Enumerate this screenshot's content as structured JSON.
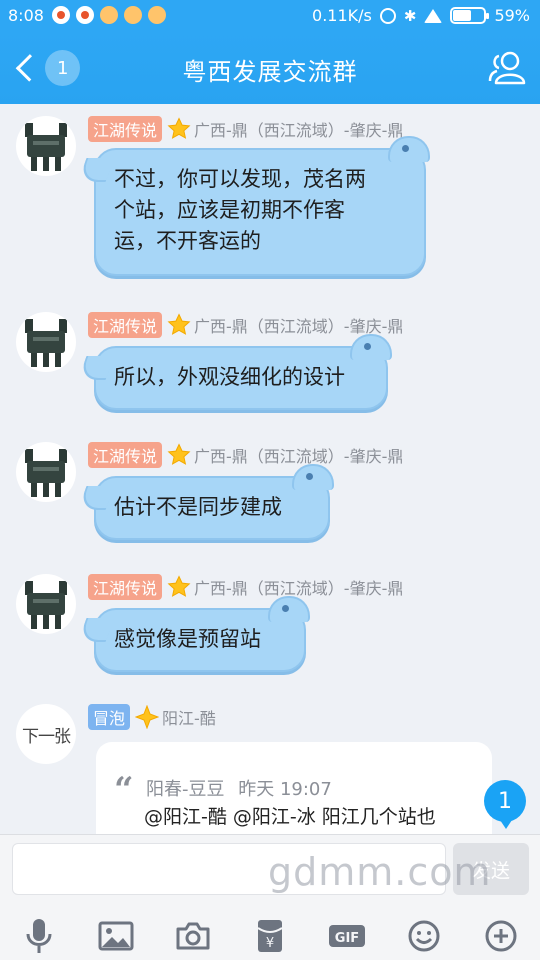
{
  "status_bar": {
    "time": "8:08",
    "network_speed": "0.11K/s",
    "battery": "59%",
    "battery_level": 0.59
  },
  "header": {
    "back_badge": "1",
    "title": "粤西发展交流群"
  },
  "messages": [
    {
      "badge": "江湖传说",
      "sender": "广西-鼎（西江流域）-肇庆-鼎",
      "lines": [
        "不过，你可以发现，茂名两",
        "个站，应该是初期不作客",
        "运，不开客运的"
      ]
    },
    {
      "badge": "江湖传说",
      "sender": "广西-鼎（西江流域）-肇庆-鼎",
      "lines": [
        "所以，外观没细化的设计"
      ]
    },
    {
      "badge": "江湖传说",
      "sender": "广西-鼎（西江流域）-肇庆-鼎",
      "lines": [
        "估计不是同步建成"
      ]
    },
    {
      "badge": "江湖传说",
      "sender": "广西-鼎（西江流域）-肇庆-鼎",
      "lines": [
        "感觉像是预留站"
      ]
    },
    {
      "badge": "冒泡",
      "sender": "阳江-酷",
      "avatar_text": "下一张"
    }
  ],
  "quote": {
    "author": "阳春-豆豆",
    "time": "昨天 19:07",
    "text": "@阳江-酷 @阳江-冰 阳江几个站也"
  },
  "new_message_count": "1",
  "input": {
    "value": "",
    "send_label": "发送"
  },
  "toolbar_icons": [
    "microphone-icon",
    "image-icon",
    "camera-icon",
    "red-packet-icon",
    "gif-icon",
    "emoji-icon",
    "plus-icon"
  ],
  "toolbar_gif_label": "GIF",
  "toolbar_redpacket_label": "¥",
  "watermark": "gdmm.com",
  "colors": {
    "header": "#2ea7f4",
    "bubble": "#a7d6f7",
    "badge_jianghu": "#f6a38b",
    "badge_maopao": "#7db4f0"
  }
}
